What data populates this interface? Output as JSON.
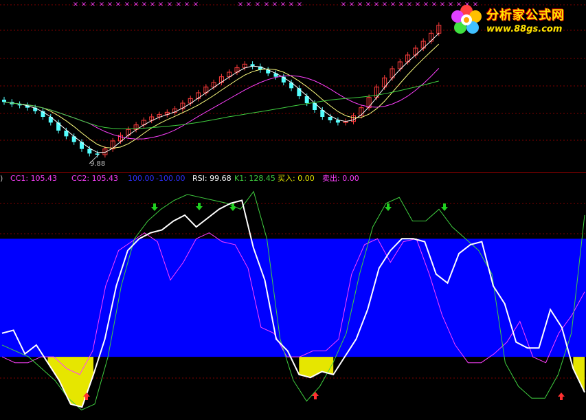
{
  "colors": {
    "background": "#000000",
    "up_candle": "#ff3c3c",
    "down_candle": "#54ffff",
    "ma_fast": "#ffffff",
    "ma_mid": "#ffff80",
    "ma_slow": "#ff40ff",
    "ma_long": "#40d040",
    "rsi_line": "#ffffff",
    "k1_line": "#40d040",
    "cc1_line": "#ff40ff",
    "overbought_band": "#0000ff",
    "oversold_fill": "#e6e600",
    "buy_arrow": "#ff3030",
    "sell_arrow": "#20d020",
    "divider": "#a00000",
    "gridline": "#800000"
  },
  "logo": {
    "title": "分析家公式网",
    "url": "www.88gs.com",
    "icon": "flower-logo-icon"
  },
  "price_panel": {
    "low_marker": "9.88",
    "icons": {
      "up_marker": "x-marker-icon"
    }
  },
  "indicator_header": {
    "prefix": ")",
    "cc1": "CC1: 105.43",
    "cc2": "CC2: 105.43",
    "upper": "100.00",
    "lower": "-100.00",
    "rsi": "RSI: 99.68",
    "k1": "K1: 128.45",
    "buy": "买入: 0.00",
    "sell": "卖出: 0.00"
  },
  "chart_data": [
    {
      "type": "candlestick",
      "title": "",
      "annotations": [
        "9.88"
      ],
      "series": [
        {
          "name": "",
          "values": [
            14.5,
            14.3,
            14.2,
            14.0,
            13.7,
            13.2,
            12.7,
            12.0,
            11.5,
            11.0,
            10.4,
            10.0,
            9.9,
            10.4,
            11.1,
            11.6,
            12.1,
            12.5,
            12.9,
            13.2,
            13.4,
            13.6,
            13.9,
            14.4,
            14.8,
            15.3,
            15.8,
            16.2,
            16.7,
            17.1,
            17.5,
            17.8,
            17.6,
            17.3,
            17.0,
            16.7,
            16.2,
            15.7,
            15.0,
            14.4,
            13.8,
            13.2,
            12.9,
            12.7,
            12.8,
            13.3,
            14.0,
            14.9,
            15.8,
            16.6,
            17.4,
            18.0,
            18.6,
            19.2,
            19.8,
            20.5,
            21.2
          ]
        }
      ]
    },
    {
      "type": "line",
      "title": "",
      "series": [
        {
          "name": "RSI",
          "values": [
            -60,
            -55,
            -95,
            -80,
            -110,
            -140,
            -180,
            -185,
            -130,
            -70,
            20,
            80,
            100,
            110,
            115,
            130,
            140,
            120,
            135,
            150,
            160,
            165,
            85,
            30,
            -70,
            -90,
            -130,
            -135,
            -125,
            -130,
            -100,
            -70,
            -20,
            50,
            80,
            100,
            100,
            95,
            40,
            25,
            75,
            90,
            95,
            20,
            -10,
            -75,
            -85,
            -85,
            -20,
            -50,
            -120,
            -160
          ]
        },
        {
          "name": "K1",
          "values": [
            -80,
            -90,
            -100,
            -120,
            -140,
            -170,
            -190,
            -180,
            -100,
            20,
            100,
            130,
            150,
            165,
            175,
            170,
            165,
            160,
            150,
            180,
            100,
            -70,
            -140,
            -175,
            -150,
            -110,
            -60,
            40,
            120,
            160,
            170,
            130,
            130,
            150,
            120,
            100,
            80,
            40,
            -110,
            -150,
            -170,
            -170,
            -130,
            -60,
            140
          ]
        },
        {
          "name": "CC1",
          "values": [
            -100,
            -110,
            -110,
            -100,
            -100,
            -120,
            -130,
            -90,
            20,
            80,
            95,
            110,
            95,
            30,
            60,
            100,
            110,
            95,
            90,
            50,
            -50,
            -60,
            -100,
            -100,
            -90,
            -90,
            -70,
            40,
            90,
            100,
            60,
            95,
            100,
            40,
            -30,
            -80,
            -110,
            -110,
            -95,
            -75,
            -40,
            -100,
            -110,
            -60,
            -30,
            10
          ]
        }
      ],
      "levels": [
        100,
        -100
      ]
    }
  ]
}
